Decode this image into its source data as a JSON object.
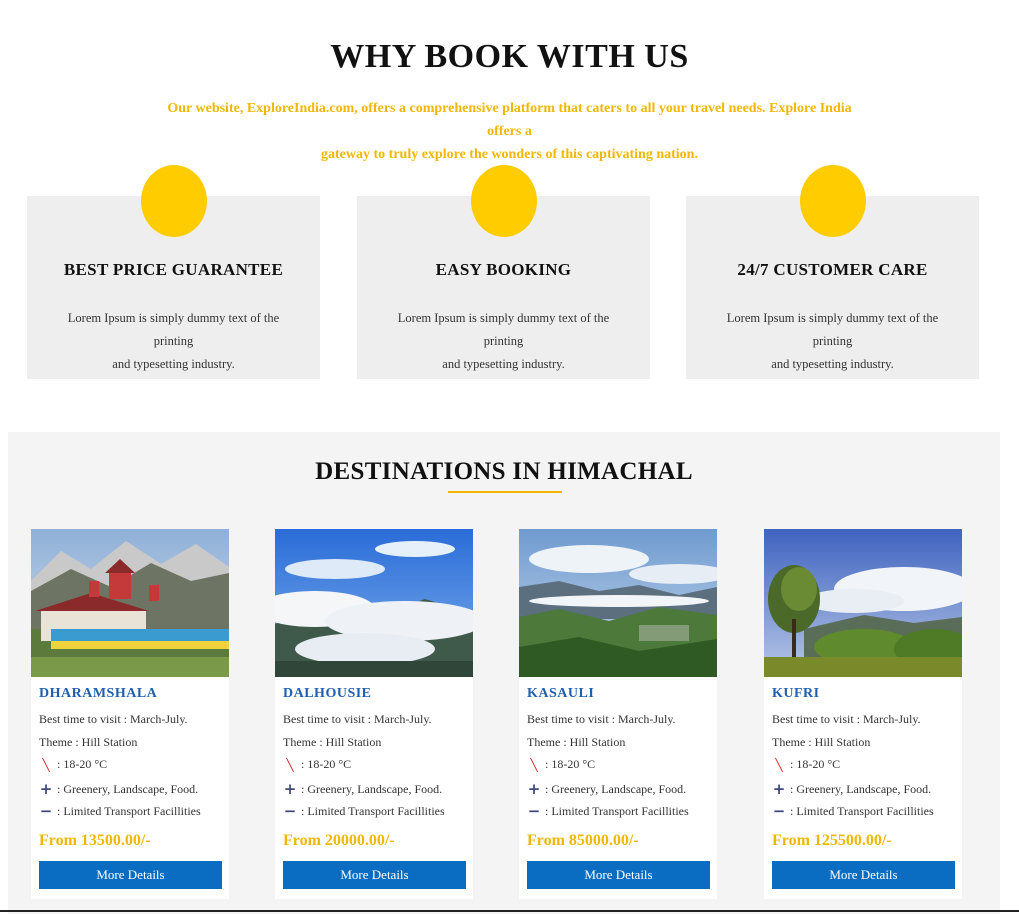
{
  "why": {
    "title": "WHY BOOK WITH US",
    "subtitle_line1": "Our website, ExploreIndia.com, offers a comprehensive platform that caters to all your travel needs. Explore India offers a",
    "subtitle_line2": "gateway to truly explore the wonders of this captivating nation.",
    "features": [
      {
        "title": "BEST PRICE GUARANTEE",
        "text_line1": "Lorem Ipsum is simply dummy text of the printing",
        "text_line2": "and typesetting industry."
      },
      {
        "title": "EASY BOOKING",
        "text_line1": "Lorem Ipsum is simply dummy text of the printing",
        "text_line2": "and typesetting industry."
      },
      {
        "title": "24/7 CUSTOMER CARE",
        "text_line1": "Lorem Ipsum is simply dummy text of the printing",
        "text_line2": "and typesetting industry."
      }
    ]
  },
  "destinations": {
    "title": "DESTINATIONS IN HIMACHAL",
    "cards": [
      {
        "name": "DHARAMSHALA",
        "best_time": "Best time to visit : March-July.",
        "theme": "Theme : Hill Station",
        "temp": ": 18-20 °C",
        "pros": ": Greenery, Landscape, Food.",
        "cons": ": Limited Transport Facillities",
        "price": "From 13500.00/-",
        "button": "More Details"
      },
      {
        "name": "DALHOUSIE",
        "best_time": "Best time to visit : March-July.",
        "theme": "Theme : Hill Station",
        "temp": ": 18-20 °C",
        "pros": ": Greenery, Landscape, Food.",
        "cons": ": Limited Transport Facillities",
        "price": "From 20000.00/-",
        "button": "More Details"
      },
      {
        "name": "KASAULI",
        "best_time": "Best time to visit : March-July.",
        "theme": "Theme : Hill Station",
        "temp": ": 18-20 °C",
        "pros": ": Greenery, Landscape, Food.",
        "cons": ": Limited Transport Facillities",
        "price": "From 85000.00/-",
        "button": "More Details"
      },
      {
        "name": "KUFRI",
        "best_time": "Best time to visit : March-July.",
        "theme": "Theme : Hill Station",
        "temp": ": 18-20 °C",
        "pros": ": Greenery, Landscape, Food.",
        "cons": ": Limited Transport Facillities",
        "price": "From 125500.00/-",
        "button": "More Details"
      }
    ]
  },
  "icons": {
    "feature_circle": "yellow-circle-icon",
    "temperature": "thermometer-icon",
    "pros": "plus-icon",
    "cons": "minus-icon"
  },
  "colors": {
    "accent_yellow": "#f2b705",
    "circle_yellow": "#ffcc00",
    "title_blue": "#1f5fae",
    "button_blue": "#0a6dc2",
    "feature_bg": "#eeeeee",
    "section_bg": "#f4f4f4"
  }
}
